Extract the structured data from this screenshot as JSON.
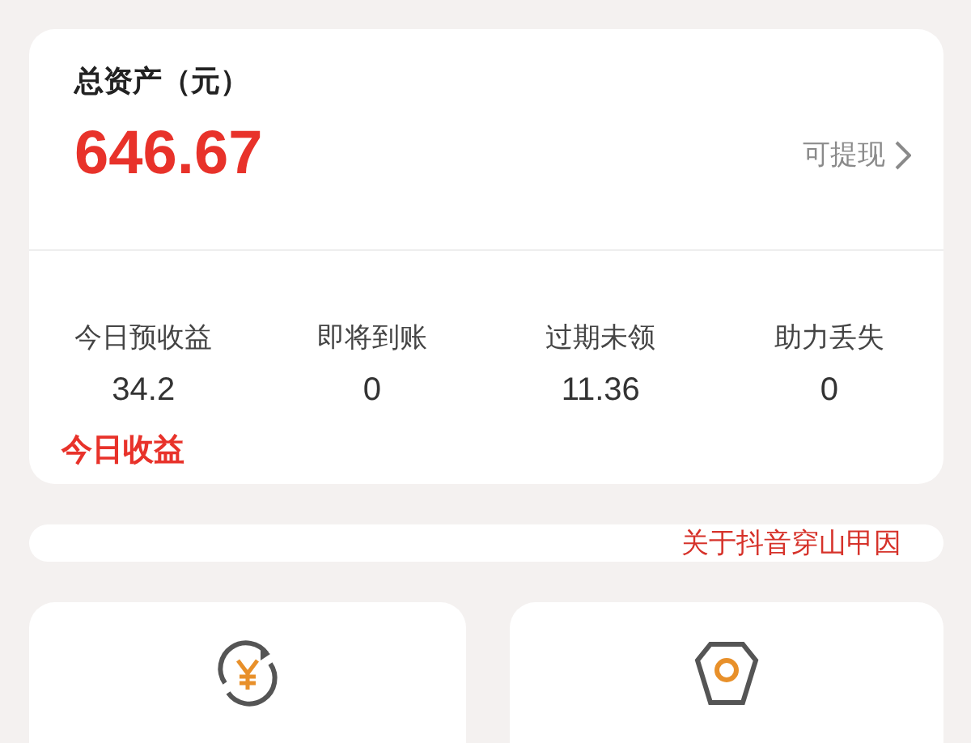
{
  "assets": {
    "title": "总资产（元）",
    "amount": "646.67",
    "withdraw_link": "可提现"
  },
  "stats": [
    {
      "label": "今日预收益",
      "value": "34.2"
    },
    {
      "label": "即将到账",
      "value": "0"
    },
    {
      "label": "过期未领",
      "value": "11.36"
    },
    {
      "label": "助力丢失",
      "value": "0"
    }
  ],
  "today_income_label": "今日收益",
  "notice": {
    "text": "关于抖音穿山甲因"
  },
  "tiles": [
    {
      "kind": "yen-refresh"
    },
    {
      "kind": "bag"
    }
  ]
}
